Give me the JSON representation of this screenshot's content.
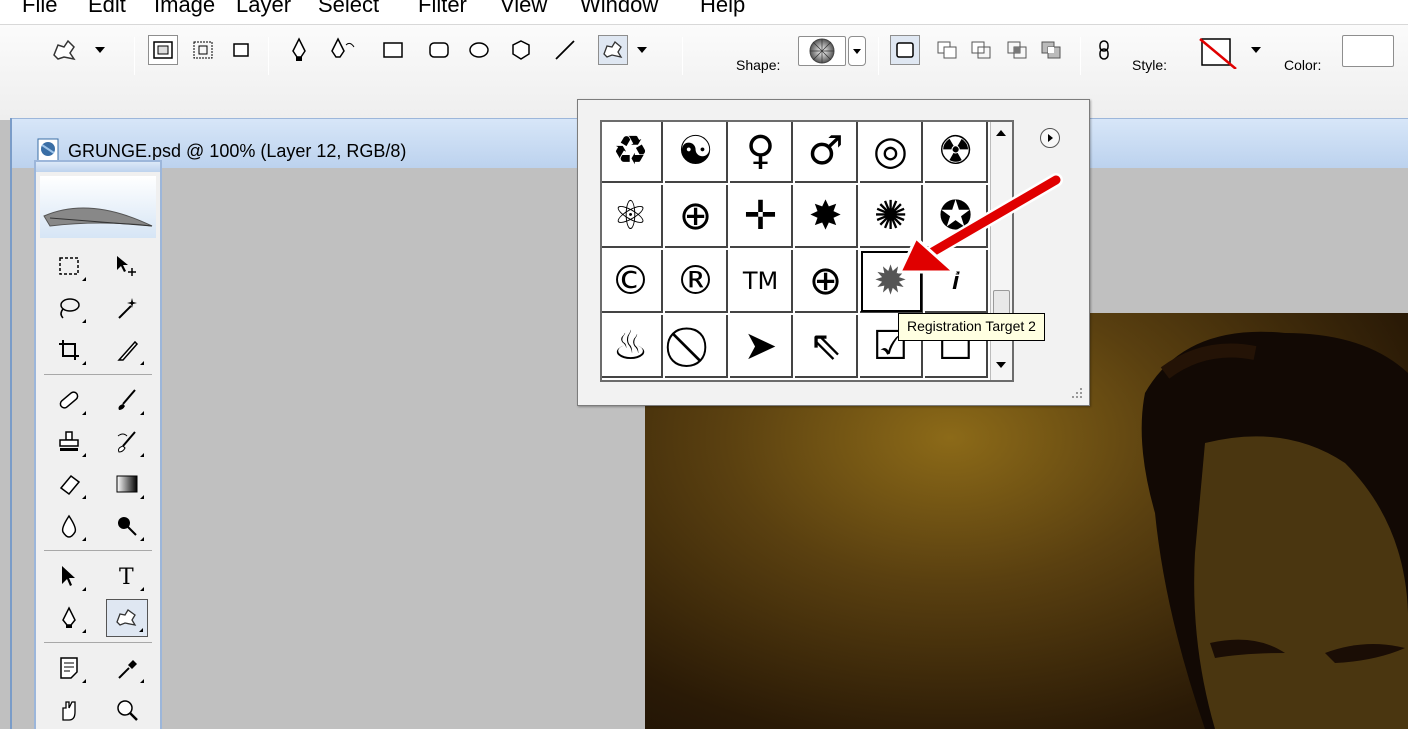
{
  "menu": [
    "File",
    "Edit",
    "Image",
    "Layer",
    "Select",
    "Filter",
    "View",
    "Window",
    "Help"
  ],
  "options_bar": {
    "shape_label": "Shape:",
    "style_label": "Style:",
    "color_label": "Color:",
    "tool_icons": [
      "custom-shape-preset-icon",
      "shape-layers-icon",
      "paths-icon",
      "fill-pixels-icon",
      "pen-icon",
      "freeform-pen-icon",
      "rectangle-icon",
      "rounded-rectangle-icon",
      "ellipse-icon",
      "polygon-icon",
      "line-icon",
      "custom-shape-icon"
    ]
  },
  "document": {
    "title": "GRUNGE.psd @ 100% (Layer 12, RGB/8)"
  },
  "shape_picker": {
    "rows": [
      [
        {
          "name": "recycle",
          "glyph": "♻"
        },
        {
          "name": "yin-yang",
          "glyph": "☯"
        },
        {
          "name": "female",
          "glyph": "♀"
        },
        {
          "name": "male",
          "glyph": "♂"
        },
        {
          "name": "target",
          "glyph": "◎"
        },
        {
          "name": "radiation",
          "glyph": "☢"
        }
      ],
      [
        {
          "name": "atom",
          "glyph": "⚛"
        },
        {
          "name": "globe",
          "glyph": "⊕"
        },
        {
          "name": "compass",
          "glyph": "✛"
        },
        {
          "name": "burst",
          "glyph": "✸"
        },
        {
          "name": "burst-outline",
          "glyph": "✺"
        },
        {
          "name": "star",
          "glyph": "✪"
        }
      ],
      [
        {
          "name": "copyright",
          "glyph": "©"
        },
        {
          "name": "registered",
          "glyph": "®"
        },
        {
          "name": "trademark",
          "glyph": "TM"
        },
        {
          "name": "registration-target",
          "glyph": "⊕"
        },
        {
          "name": "registration-target-2",
          "glyph": "✹"
        },
        {
          "name": "info",
          "glyph": "𝒊"
        }
      ],
      [
        {
          "name": "fire",
          "glyph": "♨"
        },
        {
          "name": "no-symbol",
          "glyph": "⃠"
        },
        {
          "name": "arrow-cursor",
          "glyph": "➤"
        },
        {
          "name": "arrow-cursor-outline",
          "glyph": "⇖"
        },
        {
          "name": "checkbox-checked",
          "glyph": "☑"
        },
        {
          "name": "checkbox",
          "glyph": "☐"
        }
      ]
    ],
    "selected": "registration-target-2"
  },
  "tooltip": "Registration Target 2",
  "colors": {
    "accent": "#e00000",
    "panel_border": "#9cb6da",
    "toolbar_bg": "#f4f4f4",
    "canvas_bg": "#c0c0c0"
  }
}
